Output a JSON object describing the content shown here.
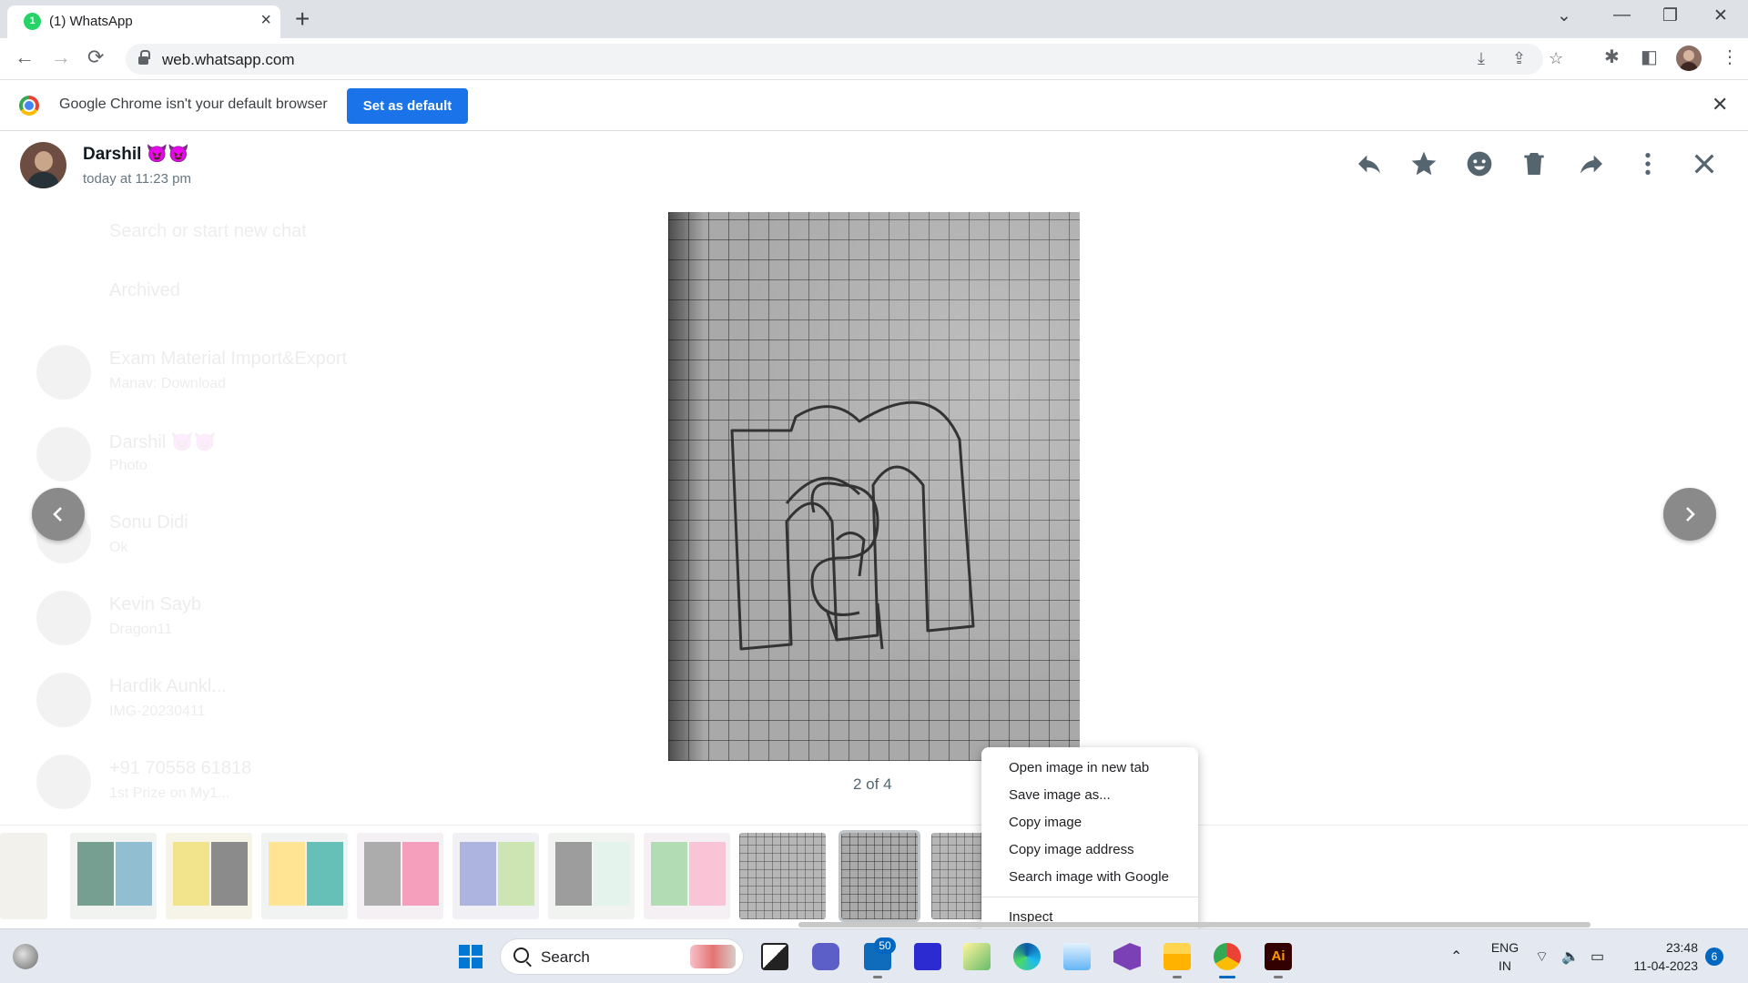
{
  "browser": {
    "tab_title": "(1) WhatsApp",
    "tab_favicon_badge": "1",
    "url": "web.whatsapp.com"
  },
  "infobar": {
    "message": "Google Chrome isn't your default browser",
    "button_label": "Set as default"
  },
  "viewer": {
    "contact_name": "Darshil 😈😈",
    "timestamp": "today at 11:23 pm",
    "counter": "2 of 4",
    "icons": [
      "reply-icon",
      "star-icon",
      "emoji-icon",
      "delete-icon",
      "forward-icon",
      "menu-icon",
      "close-icon"
    ]
  },
  "background_chats": [
    {
      "name": "Search or start new chat",
      "sub": ""
    },
    {
      "name": "Archived",
      "sub": ""
    },
    {
      "name": "Exam Material Import&Export",
      "sub": "Manav: Download"
    },
    {
      "name": "Darshil 😈😈",
      "sub": "Photo"
    },
    {
      "name": "Sonu Didi",
      "sub": "Ok"
    },
    {
      "name": "Kevin Sayb",
      "sub": "Dragon11"
    },
    {
      "name": "Hardik Aunkl...",
      "sub": "IMG-20230411"
    },
    {
      "name": "+91 70558 61818",
      "sub": "1st Prize on My1..."
    }
  ],
  "context_menu": {
    "items": [
      "Open image in new tab",
      "Save image as...",
      "Copy image",
      "Copy image address",
      "Search image with Google"
    ],
    "inspect": "Inspect"
  },
  "taskbar": {
    "search_label": "Search",
    "mail_badge": "50",
    "lang_line1": "ENG",
    "lang_line2": "IN",
    "time": "23:48",
    "date": "11-04-2023",
    "notification_count": "6"
  },
  "colors": {
    "chrome_blue": "#1a73e8",
    "whatsapp_green": "#25d366",
    "windows_accent": "#0067c0"
  }
}
